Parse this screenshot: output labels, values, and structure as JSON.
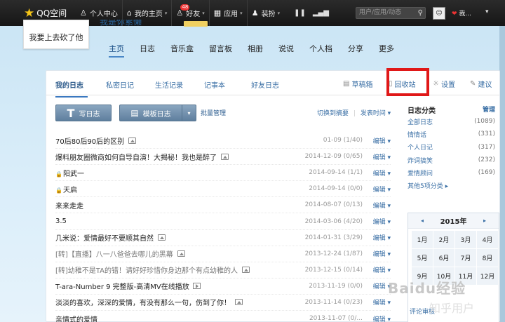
{
  "topbar": {
    "logo": "QQ空间",
    "nav": [
      {
        "icon": "person-icon",
        "glyph": "♙",
        "label": "个人中心"
      },
      {
        "icon": "home-icon",
        "glyph": "⌂",
        "label": "我的主页",
        "caret": "▾"
      },
      {
        "icon": "friends-icon",
        "glyph": "♙",
        "label": "好友",
        "badge": "48",
        "caret": "▾"
      },
      {
        "icon": "apps-icon",
        "glyph": "▦",
        "label": "应用",
        "caret": "▾"
      },
      {
        "icon": "shirt-icon",
        "glyph": "♟",
        "label": "装扮",
        "caret": "▾"
      }
    ],
    "search_placeholder": "用户/应用/动态",
    "user_text": "我...",
    "more": "▾"
  },
  "profile": {
    "avatar_text": "我要上去砍了他",
    "name": "我是你累懒"
  },
  "main_tabs": [
    "主页",
    "日志",
    "音乐盒",
    "留言板",
    "相册",
    "说说",
    "个人档",
    "分享",
    "更多"
  ],
  "sub_tabs": [
    "我的日志",
    "私密日记",
    "生活记录",
    "记事本",
    "好友日志"
  ],
  "right_links": [
    {
      "icon": "draft-icon",
      "glyph": "▤",
      "label": "草稿箱"
    },
    {
      "icon": "trash-icon",
      "glyph": "▯",
      "label": "回收站"
    },
    {
      "icon": "gear-icon",
      "glyph": "☼",
      "label": "设置"
    },
    {
      "icon": "edit-icon",
      "glyph": "✎",
      "label": "建议"
    }
  ],
  "toolbar": {
    "write": "写日志",
    "template": "模板日志",
    "batch": "批量管理",
    "switch": "切换到摘要",
    "sort": "发表时间 ▾"
  },
  "posts": [
    {
      "title": "70后80后90后的区别",
      "img": true,
      "date": "01-09",
      "stats": "(1/40)"
    },
    {
      "title": "爆料朋友圈微商如何自导自演！大揭秘！我也是醉了",
      "img": true,
      "date": "2014-12-09",
      "stats": "(0/65)"
    },
    {
      "title": "阳武一",
      "lock": true,
      "date": "2014-09-14",
      "stats": "(1/1)"
    },
    {
      "title": "天启",
      "lock": true,
      "date": "2014-09-14",
      "stats": "(0/0)"
    },
    {
      "title": "来来走走",
      "date": "2014-08-07",
      "stats": "(0/13)"
    },
    {
      "title": "3.5",
      "date": "2014-03-06",
      "stats": "(4/20)"
    },
    {
      "title": "几米说：爱情最好不要顺其自然",
      "img": true,
      "date": "2014-01-31",
      "stats": "(3/29)"
    },
    {
      "title": "[转]【直播】八一八爸爸去哪儿的黑幕",
      "img": true,
      "date": "2013-12-24",
      "stats": "(1/87)"
    },
    {
      "title": "[转]幼稚不是TA的错！请好好珍惜你身边那个有点幼稚的人",
      "img": true,
      "date": "2013-12-15",
      "stats": "(0/14)"
    },
    {
      "title": "T-ara-Number 9 完整版-高清MV在线播放",
      "vid": true,
      "date": "2013-11-19",
      "stats": "(0/0)"
    },
    {
      "title": "淡淡的喜欢，深深的爱情，有没有那么一句，伤到了你！",
      "img": true,
      "date": "2013-11-14",
      "stats": "(0/23)"
    },
    {
      "title": "亲情式的爱情",
      "date": "2013-11-07",
      "stats": "(0/..."
    }
  ],
  "edit_label": "编辑 ▾",
  "sidebar": {
    "title": "日志分类",
    "manage": "管理",
    "categories": [
      {
        "name": "全部日志",
        "count": "(1089)"
      },
      {
        "name": "情情话",
        "count": "(331)"
      },
      {
        "name": "个人日记",
        "count": "(317)"
      },
      {
        "name": "炸词搞笑",
        "count": "(232)"
      },
      {
        "name": "爱情顾问",
        "count": "(169)"
      }
    ],
    "more_categories": "其他5项分类 ▸"
  },
  "calendar": {
    "year": "2015年",
    "prev": "◂",
    "next": "▸",
    "months": [
      "1月",
      "2月",
      "3月",
      "4月",
      "5月",
      "6月",
      "7月",
      "8月",
      "9月",
      "10月",
      "11月",
      "12月"
    ],
    "footer": "评论审核"
  },
  "watermark": "Baidu经验",
  "watermark2": "知乎用户"
}
